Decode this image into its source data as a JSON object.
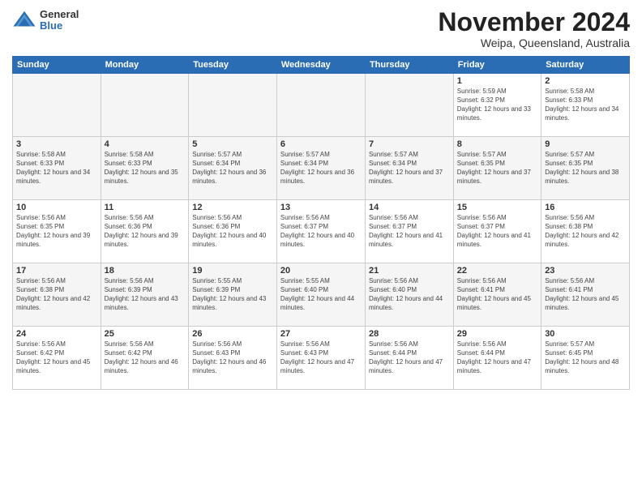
{
  "header": {
    "logo_general": "General",
    "logo_blue": "Blue",
    "month_title": "November 2024",
    "location": "Weipa, Queensland, Australia"
  },
  "days_of_week": [
    "Sunday",
    "Monday",
    "Tuesday",
    "Wednesday",
    "Thursday",
    "Friday",
    "Saturday"
  ],
  "weeks": [
    [
      {
        "day": "",
        "empty": true
      },
      {
        "day": "",
        "empty": true
      },
      {
        "day": "",
        "empty": true
      },
      {
        "day": "",
        "empty": true
      },
      {
        "day": "",
        "empty": true
      },
      {
        "day": "1",
        "sunrise": "5:59 AM",
        "sunset": "6:32 PM",
        "daylight": "12 hours and 33 minutes."
      },
      {
        "day": "2",
        "sunrise": "5:58 AM",
        "sunset": "6:33 PM",
        "daylight": "12 hours and 34 minutes."
      }
    ],
    [
      {
        "day": "3",
        "sunrise": "5:58 AM",
        "sunset": "6:33 PM",
        "daylight": "12 hours and 34 minutes."
      },
      {
        "day": "4",
        "sunrise": "5:58 AM",
        "sunset": "6:33 PM",
        "daylight": "12 hours and 35 minutes."
      },
      {
        "day": "5",
        "sunrise": "5:57 AM",
        "sunset": "6:34 PM",
        "daylight": "12 hours and 36 minutes."
      },
      {
        "day": "6",
        "sunrise": "5:57 AM",
        "sunset": "6:34 PM",
        "daylight": "12 hours and 36 minutes."
      },
      {
        "day": "7",
        "sunrise": "5:57 AM",
        "sunset": "6:34 PM",
        "daylight": "12 hours and 37 minutes."
      },
      {
        "day": "8",
        "sunrise": "5:57 AM",
        "sunset": "6:35 PM",
        "daylight": "12 hours and 37 minutes."
      },
      {
        "day": "9",
        "sunrise": "5:57 AM",
        "sunset": "6:35 PM",
        "daylight": "12 hours and 38 minutes."
      }
    ],
    [
      {
        "day": "10",
        "sunrise": "5:56 AM",
        "sunset": "6:35 PM",
        "daylight": "12 hours and 39 minutes."
      },
      {
        "day": "11",
        "sunrise": "5:56 AM",
        "sunset": "6:36 PM",
        "daylight": "12 hours and 39 minutes."
      },
      {
        "day": "12",
        "sunrise": "5:56 AM",
        "sunset": "6:36 PM",
        "daylight": "12 hours and 40 minutes."
      },
      {
        "day": "13",
        "sunrise": "5:56 AM",
        "sunset": "6:37 PM",
        "daylight": "12 hours and 40 minutes."
      },
      {
        "day": "14",
        "sunrise": "5:56 AM",
        "sunset": "6:37 PM",
        "daylight": "12 hours and 41 minutes."
      },
      {
        "day": "15",
        "sunrise": "5:56 AM",
        "sunset": "6:37 PM",
        "daylight": "12 hours and 41 minutes."
      },
      {
        "day": "16",
        "sunrise": "5:56 AM",
        "sunset": "6:38 PM",
        "daylight": "12 hours and 42 minutes."
      }
    ],
    [
      {
        "day": "17",
        "sunrise": "5:56 AM",
        "sunset": "6:38 PM",
        "daylight": "12 hours and 42 minutes."
      },
      {
        "day": "18",
        "sunrise": "5:56 AM",
        "sunset": "6:39 PM",
        "daylight": "12 hours and 43 minutes."
      },
      {
        "day": "19",
        "sunrise": "5:55 AM",
        "sunset": "6:39 PM",
        "daylight": "12 hours and 43 minutes."
      },
      {
        "day": "20",
        "sunrise": "5:55 AM",
        "sunset": "6:40 PM",
        "daylight": "12 hours and 44 minutes."
      },
      {
        "day": "21",
        "sunrise": "5:56 AM",
        "sunset": "6:40 PM",
        "daylight": "12 hours and 44 minutes."
      },
      {
        "day": "22",
        "sunrise": "5:56 AM",
        "sunset": "6:41 PM",
        "daylight": "12 hours and 45 minutes."
      },
      {
        "day": "23",
        "sunrise": "5:56 AM",
        "sunset": "6:41 PM",
        "daylight": "12 hours and 45 minutes."
      }
    ],
    [
      {
        "day": "24",
        "sunrise": "5:56 AM",
        "sunset": "6:42 PM",
        "daylight": "12 hours and 45 minutes."
      },
      {
        "day": "25",
        "sunrise": "5:56 AM",
        "sunset": "6:42 PM",
        "daylight": "12 hours and 46 minutes."
      },
      {
        "day": "26",
        "sunrise": "5:56 AM",
        "sunset": "6:43 PM",
        "daylight": "12 hours and 46 minutes."
      },
      {
        "day": "27",
        "sunrise": "5:56 AM",
        "sunset": "6:43 PM",
        "daylight": "12 hours and 47 minutes."
      },
      {
        "day": "28",
        "sunrise": "5:56 AM",
        "sunset": "6:44 PM",
        "daylight": "12 hours and 47 minutes."
      },
      {
        "day": "29",
        "sunrise": "5:56 AM",
        "sunset": "6:44 PM",
        "daylight": "12 hours and 47 minutes."
      },
      {
        "day": "30",
        "sunrise": "5:57 AM",
        "sunset": "6:45 PM",
        "daylight": "12 hours and 48 minutes."
      }
    ]
  ]
}
